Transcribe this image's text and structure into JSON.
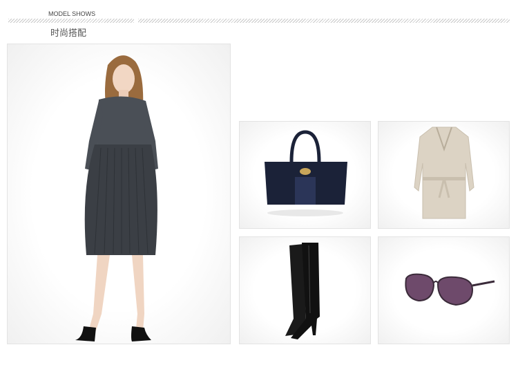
{
  "header": {
    "title_en": "MODEL SHOWS",
    "title_cn": "时尚搭配"
  },
  "cards": {
    "model": {
      "name": "model"
    },
    "handbag": {
      "name": "handbag"
    },
    "trench_coat": {
      "name": "trench-coat"
    },
    "boots": {
      "name": "boots"
    },
    "sunglasses": {
      "name": "sunglasses"
    }
  },
  "colors": {
    "dress": "#3b3f45",
    "bag": "#1b2238",
    "coat": "#dcd3c4",
    "boots": "#1a1a1a",
    "lens": "#6e4a6b"
  }
}
